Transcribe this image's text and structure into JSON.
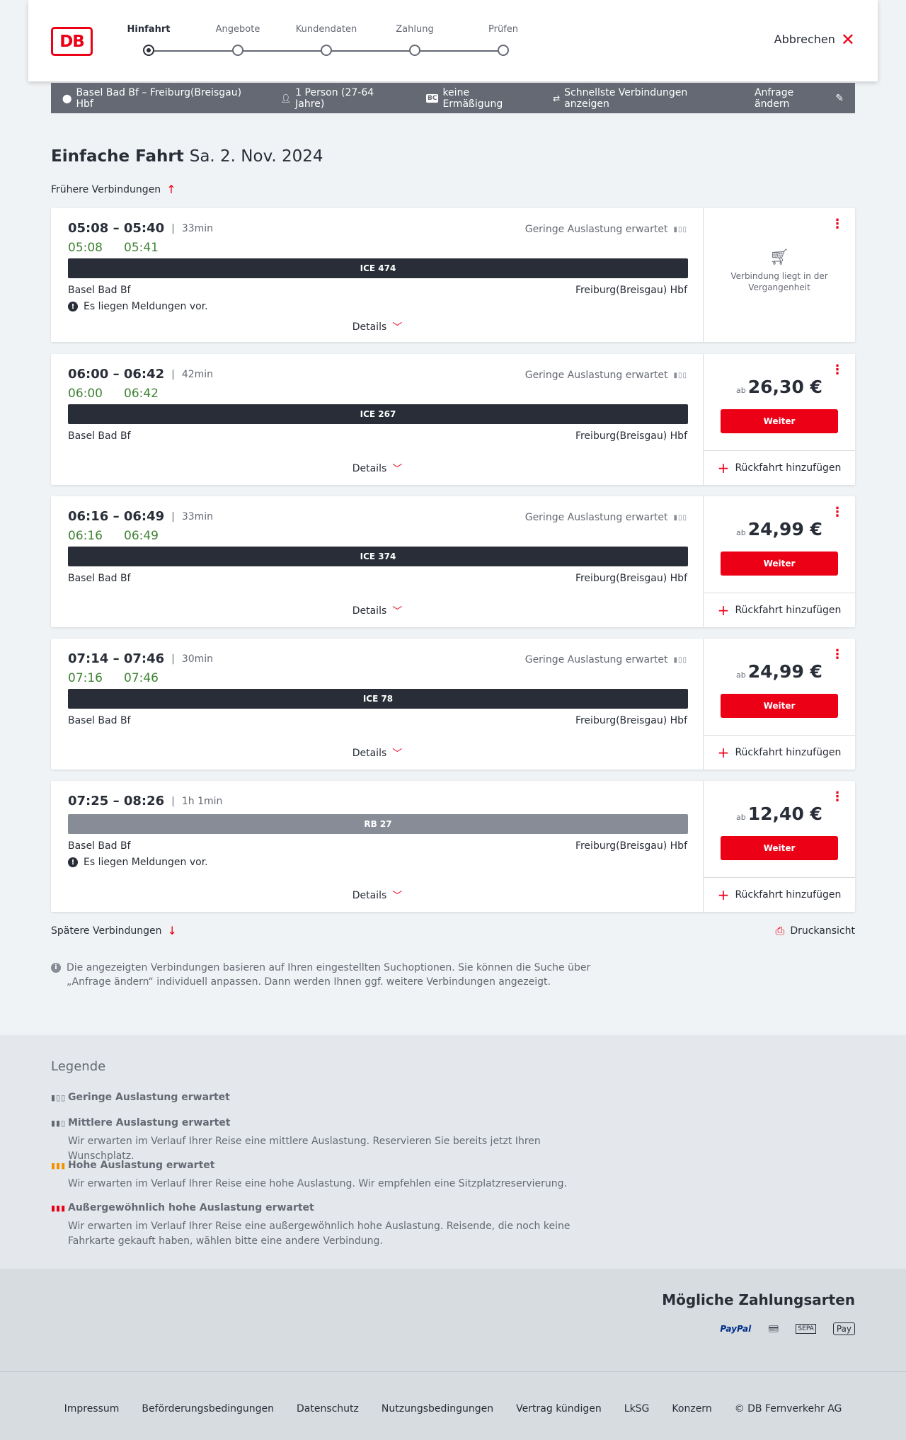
{
  "header": {
    "steps": [
      "Hinfahrt",
      "Angebote",
      "Kundendaten",
      "Zahlung",
      "Prüfen"
    ],
    "cancel_label": "Abbrechen",
    "logo_text": "DB"
  },
  "search": {
    "route": "Basel Bad Bf – Freiburg(Breisgau) Hbf",
    "passengers": "1 Person (27-64 Jahre)",
    "discount_badge": "BC",
    "discount": "keine Ermäßigung",
    "fastest": "Schnellste Verbindungen anzeigen",
    "edit": "Anfrage ändern"
  },
  "page": {
    "title": "Einfache Fahrt",
    "date": "Sa. 2. Nov. 2024",
    "earlier": "Frühere Verbindungen",
    "later": "Spätere Verbindungen",
    "print": "Druckansicht",
    "info": "Die angezeigten Verbindungen basieren auf Ihren eingestellten Suchoptionen. Sie können die Suche über „Anfrage ändern“ individuell anpassen. Dann werden Ihnen ggf. weitere Verbindungen angezeigt."
  },
  "connections": [
    {
      "times": "05:08 – 05:40",
      "duration": "33min",
      "rt_dep": "05:08",
      "rt_arr": "05:41",
      "occupancy": "Geringe Auslastung erwartet",
      "train": "ICE 474",
      "from": "Basel Bad Bf",
      "to": "Freiburg(Breisgau) Hbf",
      "message": "Es liegen Meldungen vor.",
      "details": "Details",
      "past_text": "Verbindung liegt in der Vergangenheit"
    },
    {
      "times": "06:00 – 06:42",
      "duration": "42min",
      "rt_dep": "06:00",
      "rt_arr": "06:42",
      "occupancy": "Geringe Auslastung erwartet",
      "train": "ICE 267",
      "from": "Basel Bad Bf",
      "to": "Freiburg(Breisgau) Hbf",
      "details": "Details",
      "ab": "ab",
      "price": "26,30 €",
      "button": "Weiter",
      "return": "Rückfahrt hinzufügen"
    },
    {
      "times": "06:16 – 06:49",
      "duration": "33min",
      "rt_dep": "06:16",
      "rt_arr": "06:49",
      "occupancy": "Geringe Auslastung erwartet",
      "train": "ICE 374",
      "from": "Basel Bad Bf",
      "to": "Freiburg(Breisgau) Hbf",
      "details": "Details",
      "ab": "ab",
      "price": "24,99 €",
      "button": "Weiter",
      "return": "Rückfahrt hinzufügen"
    },
    {
      "times": "07:14 – 07:46",
      "duration": "30min",
      "rt_dep": "07:16",
      "rt_arr": "07:46",
      "occupancy": "Geringe Auslastung erwartet",
      "train": "ICE 78",
      "from": "Basel Bad Bf",
      "to": "Freiburg(Breisgau) Hbf",
      "details": "Details",
      "ab": "ab",
      "price": "24,99 €",
      "button": "Weiter",
      "return": "Rückfahrt hinzufügen"
    },
    {
      "times": "07:25 – 08:26",
      "duration": "1h 1min",
      "train": "RB 27",
      "from": "Basel Bad Bf",
      "to": "Freiburg(Breisgau) Hbf",
      "message": "Es liegen Meldungen vor.",
      "details": "Details",
      "ab": "ab",
      "price": "12,40 €",
      "button": "Weiter",
      "return": "Rückfahrt hinzufügen"
    }
  ],
  "legend": {
    "title": "Legende",
    "items": [
      {
        "label": "Geringe Auslastung erwartet",
        "desc": ""
      },
      {
        "label": "Mittlere Auslastung erwartet",
        "desc": "Wir erwarten im Verlauf Ihrer Reise eine mittlere Auslastung. Reservieren Sie bereits jetzt Ihren Wunschplatz."
      },
      {
        "label": "Hohe Auslastung erwartet",
        "desc": "Wir erwarten im Verlauf Ihrer Reise eine hohe Auslastung. Wir empfehlen eine Sitzplatzreservierung."
      },
      {
        "label": "Außergewöhnlich hohe Auslastung erwartet",
        "desc": "Wir erwarten im Verlauf Ihrer Reise eine außergewöhnlich hohe Auslastung. Reisende, die noch keine Fahrkarte gekauft haben, wählen bitte eine andere Verbindung."
      }
    ]
  },
  "payment": {
    "title": "Mögliche Zahlungsarten",
    "paypal": "PayPal",
    "sepa": "SEPA",
    "applepay": "Pay"
  },
  "footer": [
    "Impressum",
    "Beförderungsbedingungen",
    "Datenschutz",
    "Nutzungsbedingungen",
    "Vertrag kündigen",
    "LkSG",
    "Konzern",
    "© DB Fernverkehr AG"
  ],
  "colors": {
    "accent": "#ec0016",
    "realtime": "#408335",
    "train": "#282d37",
    "bar": "#646973"
  }
}
